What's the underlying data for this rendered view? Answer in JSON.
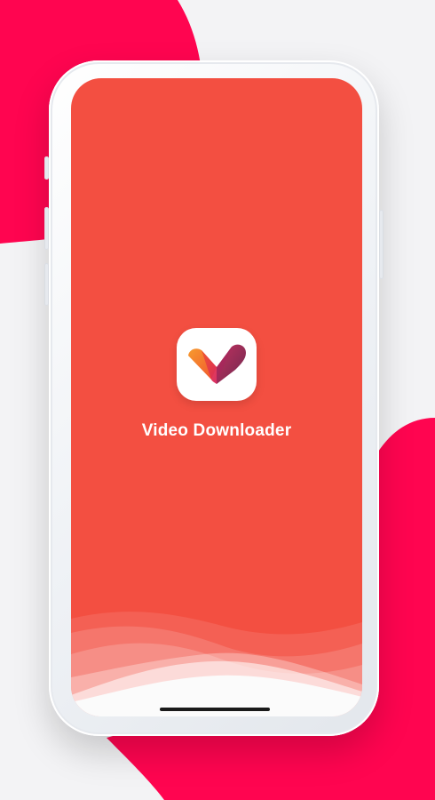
{
  "app": {
    "title": "Video Downloader",
    "logo_icon": "heart-check-logo-icon"
  },
  "colors": {
    "brand_pink": "#ff0550",
    "screen_background": "#f34f41",
    "wave_white": "#ffffff",
    "logo_orange": "#f47a2d",
    "logo_magenta": "#d8245f",
    "logo_purple": "#8a2a55"
  }
}
